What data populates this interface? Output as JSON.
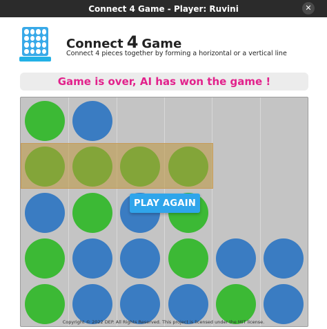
{
  "window": {
    "title": "Connect 4 Game - Player: Ruvini",
    "close_glyph": "✕"
  },
  "header": {
    "title_word1": "Connect",
    "title_num": "4",
    "title_word2": "Game",
    "subtitle": "Connect 4 pieces together by forming a horizontal or a vertical line",
    "logo_icon": "connect-four-board-icon"
  },
  "status": {
    "message": "Game is over, AI has won the game !"
  },
  "board": {
    "columns": 6,
    "rows": 5,
    "colors": {
      "green": "#3cb935",
      "blue": "#3a7cc2",
      "board_bg": "#c4c4c4",
      "highlight": "#c79a57"
    },
    "cells": [
      [
        "green",
        "blue",
        null,
        null,
        null,
        null
      ],
      [
        "green",
        "green",
        "green",
        "green",
        null,
        null
      ],
      [
        "blue",
        "green",
        "blue",
        "green",
        null,
        null
      ],
      [
        "green",
        "blue",
        "blue",
        "green",
        "blue",
        "blue"
      ],
      [
        "green",
        "blue",
        "blue",
        "blue",
        "green",
        "blue"
      ]
    ],
    "winning_row": 1
  },
  "actions": {
    "play_again_label": "PLAY AGAIN"
  },
  "footer": {
    "text": "Copyright © 2022 DEP. All Rights Reserved. This project is licensed under the MIT license."
  }
}
